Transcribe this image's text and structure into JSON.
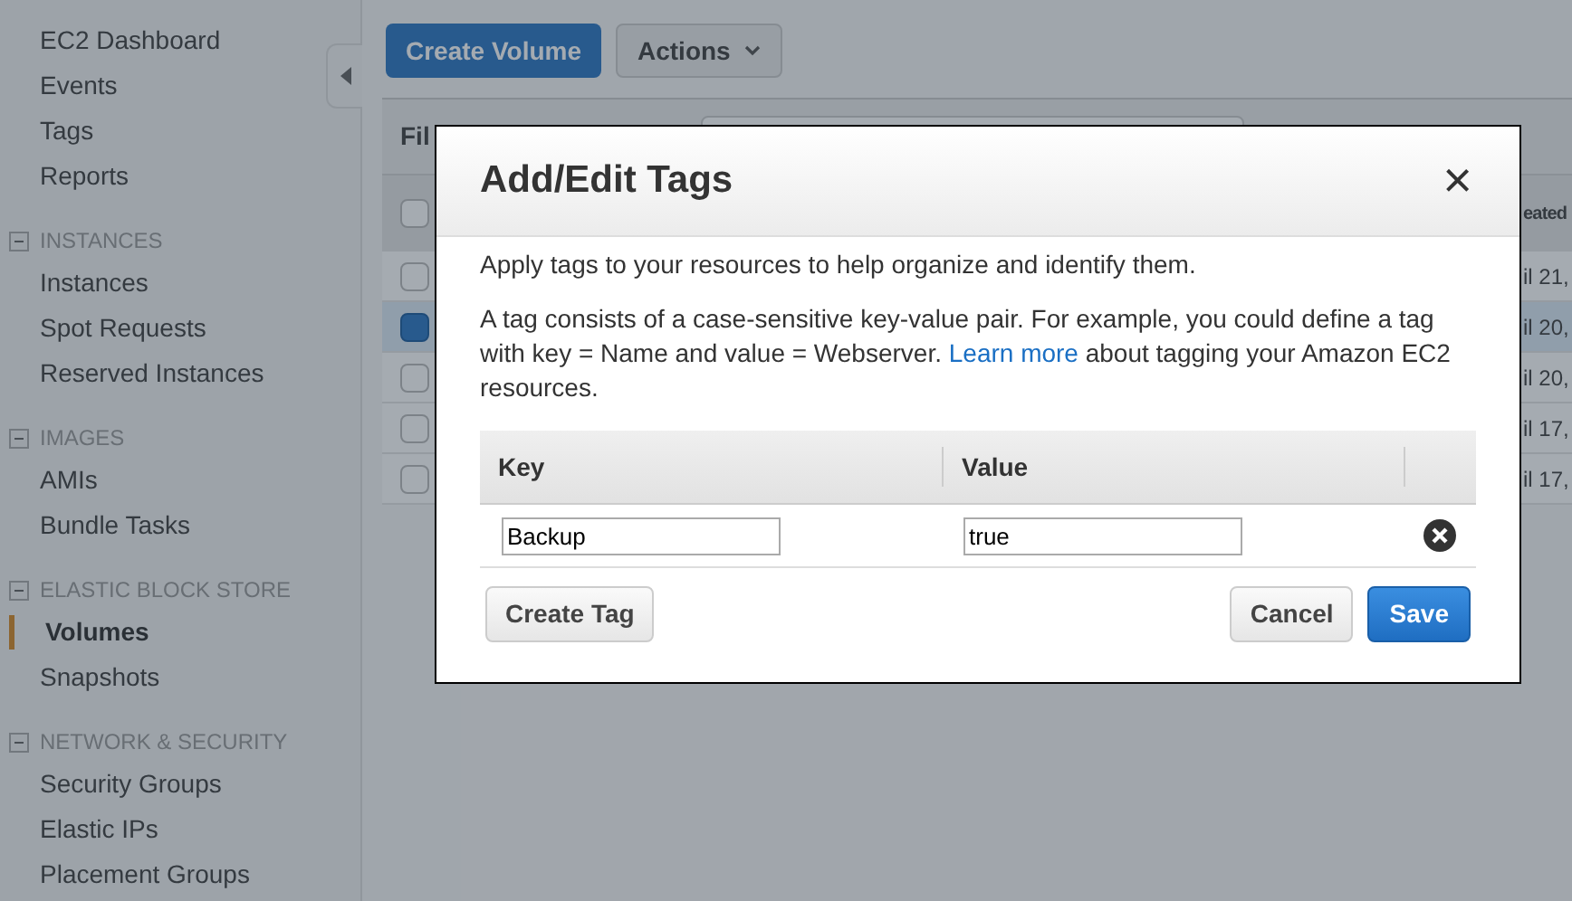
{
  "sidebar": {
    "groups": [
      {
        "items": [
          {
            "label": "EC2 Dashboard",
            "selected": false
          },
          {
            "label": "Events",
            "selected": false
          },
          {
            "label": "Tags",
            "selected": false
          },
          {
            "label": "Reports",
            "selected": false
          }
        ]
      },
      {
        "title": "INSTANCES",
        "expanded": true,
        "items": [
          {
            "label": "Instances",
            "selected": false
          },
          {
            "label": "Spot Requests",
            "selected": false
          },
          {
            "label": "Reserved Instances",
            "selected": false
          }
        ]
      },
      {
        "title": "IMAGES",
        "expanded": true,
        "items": [
          {
            "label": "AMIs",
            "selected": false
          },
          {
            "label": "Bundle Tasks",
            "selected": false
          }
        ]
      },
      {
        "title": "ELASTIC BLOCK STORE",
        "expanded": true,
        "items": [
          {
            "label": "Volumes",
            "selected": true
          },
          {
            "label": "Snapshots",
            "selected": false
          }
        ]
      },
      {
        "title": "NETWORK & SECURITY",
        "expanded": true,
        "items": [
          {
            "label": "Security Groups",
            "selected": false
          },
          {
            "label": "Elastic IPs",
            "selected": false
          },
          {
            "label": "Placement Groups",
            "selected": false
          }
        ]
      }
    ]
  },
  "toolbar": {
    "primary_button": "Create Volume",
    "actions_button": "Actions"
  },
  "volumes_table": {
    "filter_label": "Fil",
    "column_header": "eated",
    "select_all_checked": false,
    "rows": [
      {
        "checked": false,
        "column_text": "il 21,"
      },
      {
        "checked": true,
        "column_text": "il 20,"
      },
      {
        "checked": false,
        "column_text": "il 20,"
      },
      {
        "checked": false,
        "column_text": "il 17,"
      },
      {
        "checked": false,
        "column_text": "il 17,"
      }
    ]
  },
  "dialog": {
    "title": "Add/Edit Tags",
    "close": "×",
    "intro": "Apply tags to your resources to help organize and identify them.",
    "description_before": "A tag consists of a case-sensitive key-value pair. For example, you could define a tag with key = Name and value = Webserver.",
    "link": "Learn more",
    "description_after": "about tagging your Amazon EC2 resources.",
    "columns": [
      "Key",
      "Value"
    ],
    "rows": [
      {
        "key": "Backup",
        "value": "true"
      }
    ],
    "create_button": "Create Tag",
    "cancel_button": "Cancel",
    "save_button": "Save"
  }
}
